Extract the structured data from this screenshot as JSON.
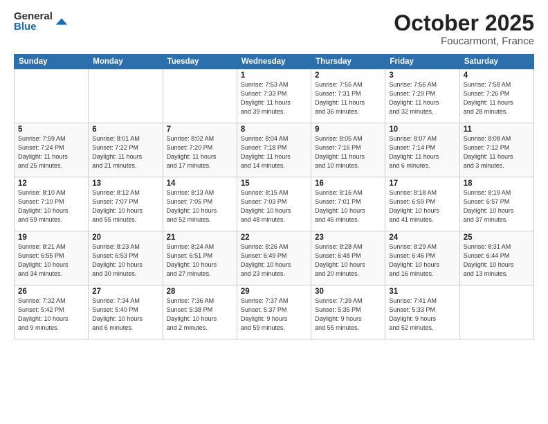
{
  "logo": {
    "general": "General",
    "blue": "Blue"
  },
  "title": "October 2025",
  "location": "Foucarmont, France",
  "days_header": [
    "Sunday",
    "Monday",
    "Tuesday",
    "Wednesday",
    "Thursday",
    "Friday",
    "Saturday"
  ],
  "weeks": [
    [
      {
        "day": "",
        "info": ""
      },
      {
        "day": "",
        "info": ""
      },
      {
        "day": "",
        "info": ""
      },
      {
        "day": "1",
        "info": "Sunrise: 7:53 AM\nSunset: 7:33 PM\nDaylight: 11 hours\nand 39 minutes."
      },
      {
        "day": "2",
        "info": "Sunrise: 7:55 AM\nSunset: 7:31 PM\nDaylight: 11 hours\nand 36 minutes."
      },
      {
        "day": "3",
        "info": "Sunrise: 7:56 AM\nSunset: 7:29 PM\nDaylight: 11 hours\nand 32 minutes."
      },
      {
        "day": "4",
        "info": "Sunrise: 7:58 AM\nSunset: 7:26 PM\nDaylight: 11 hours\nand 28 minutes."
      }
    ],
    [
      {
        "day": "5",
        "info": "Sunrise: 7:59 AM\nSunset: 7:24 PM\nDaylight: 11 hours\nand 25 minutes."
      },
      {
        "day": "6",
        "info": "Sunrise: 8:01 AM\nSunset: 7:22 PM\nDaylight: 11 hours\nand 21 minutes."
      },
      {
        "day": "7",
        "info": "Sunrise: 8:02 AM\nSunset: 7:20 PM\nDaylight: 11 hours\nand 17 minutes."
      },
      {
        "day": "8",
        "info": "Sunrise: 8:04 AM\nSunset: 7:18 PM\nDaylight: 11 hours\nand 14 minutes."
      },
      {
        "day": "9",
        "info": "Sunrise: 8:05 AM\nSunset: 7:16 PM\nDaylight: 11 hours\nand 10 minutes."
      },
      {
        "day": "10",
        "info": "Sunrise: 8:07 AM\nSunset: 7:14 PM\nDaylight: 11 hours\nand 6 minutes."
      },
      {
        "day": "11",
        "info": "Sunrise: 8:08 AM\nSunset: 7:12 PM\nDaylight: 11 hours\nand 3 minutes."
      }
    ],
    [
      {
        "day": "12",
        "info": "Sunrise: 8:10 AM\nSunset: 7:10 PM\nDaylight: 10 hours\nand 59 minutes."
      },
      {
        "day": "13",
        "info": "Sunrise: 8:12 AM\nSunset: 7:07 PM\nDaylight: 10 hours\nand 55 minutes."
      },
      {
        "day": "14",
        "info": "Sunrise: 8:13 AM\nSunset: 7:05 PM\nDaylight: 10 hours\nand 52 minutes."
      },
      {
        "day": "15",
        "info": "Sunrise: 8:15 AM\nSunset: 7:03 PM\nDaylight: 10 hours\nand 48 minutes."
      },
      {
        "day": "16",
        "info": "Sunrise: 8:16 AM\nSunset: 7:01 PM\nDaylight: 10 hours\nand 45 minutes."
      },
      {
        "day": "17",
        "info": "Sunrise: 8:18 AM\nSunset: 6:59 PM\nDaylight: 10 hours\nand 41 minutes."
      },
      {
        "day": "18",
        "info": "Sunrise: 8:19 AM\nSunset: 6:57 PM\nDaylight: 10 hours\nand 37 minutes."
      }
    ],
    [
      {
        "day": "19",
        "info": "Sunrise: 8:21 AM\nSunset: 6:55 PM\nDaylight: 10 hours\nand 34 minutes."
      },
      {
        "day": "20",
        "info": "Sunrise: 8:23 AM\nSunset: 6:53 PM\nDaylight: 10 hours\nand 30 minutes."
      },
      {
        "day": "21",
        "info": "Sunrise: 8:24 AM\nSunset: 6:51 PM\nDaylight: 10 hours\nand 27 minutes."
      },
      {
        "day": "22",
        "info": "Sunrise: 8:26 AM\nSunset: 6:49 PM\nDaylight: 10 hours\nand 23 minutes."
      },
      {
        "day": "23",
        "info": "Sunrise: 8:28 AM\nSunset: 6:48 PM\nDaylight: 10 hours\nand 20 minutes."
      },
      {
        "day": "24",
        "info": "Sunrise: 8:29 AM\nSunset: 6:46 PM\nDaylight: 10 hours\nand 16 minutes."
      },
      {
        "day": "25",
        "info": "Sunrise: 8:31 AM\nSunset: 6:44 PM\nDaylight: 10 hours\nand 13 minutes."
      }
    ],
    [
      {
        "day": "26",
        "info": "Sunrise: 7:32 AM\nSunset: 5:42 PM\nDaylight: 10 hours\nand 9 minutes."
      },
      {
        "day": "27",
        "info": "Sunrise: 7:34 AM\nSunset: 5:40 PM\nDaylight: 10 hours\nand 6 minutes."
      },
      {
        "day": "28",
        "info": "Sunrise: 7:36 AM\nSunset: 5:38 PM\nDaylight: 10 hours\nand 2 minutes."
      },
      {
        "day": "29",
        "info": "Sunrise: 7:37 AM\nSunset: 5:37 PM\nDaylight: 9 hours\nand 59 minutes."
      },
      {
        "day": "30",
        "info": "Sunrise: 7:39 AM\nSunset: 5:35 PM\nDaylight: 9 hours\nand 55 minutes."
      },
      {
        "day": "31",
        "info": "Sunrise: 7:41 AM\nSunset: 5:33 PM\nDaylight: 9 hours\nand 52 minutes."
      },
      {
        "day": "",
        "info": ""
      }
    ]
  ]
}
